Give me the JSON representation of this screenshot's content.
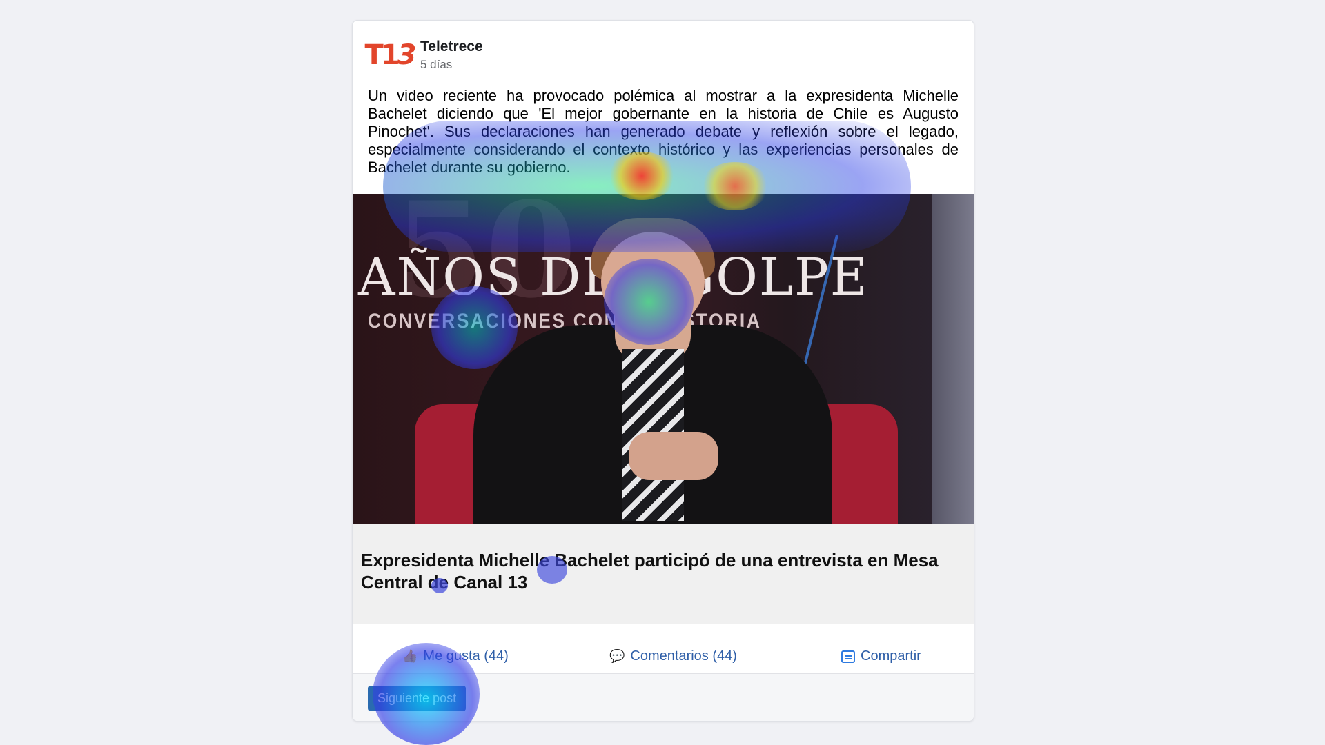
{
  "post": {
    "page_name": "Teletrece",
    "logo_text_main": "T1",
    "logo_text_three": "3",
    "time": "5 días",
    "body": "Un video reciente ha provocado polémica al mostrar a la expresidenta Michelle Bachelet diciendo que 'El mejor gobernante en la historia de Chile es Augusto Pinochet'. Sus declaraciones han generado debate y reflexión sobre el legado, especialmente considerando el contexto histórico y las experiencias personales de Bachelet durante su gobierno.",
    "image": {
      "overlay_number": "50",
      "overlay_title": "AÑOS DEL GOLPE",
      "overlay_subtitle": "CONVERSACIONES CON LA HISTORIA"
    },
    "link_caption": "Expresidenta Michelle Bachelet participó de una entrevista en Mesa Central de Canal 13"
  },
  "actions": {
    "like_label": "Me gusta (44)",
    "comment_label": "Comentarios (44)",
    "share_label": "Compartir"
  },
  "next_button_label": "Siguiente post",
  "colors": {
    "brand": "#e2452b",
    "link": "#2f5fa8",
    "button": "#2a6bb0",
    "background": "#f0f1f5"
  },
  "icons": {
    "like": "thumbs-up-icon",
    "comment": "speech-bubble-icon",
    "share": "share-icon"
  }
}
